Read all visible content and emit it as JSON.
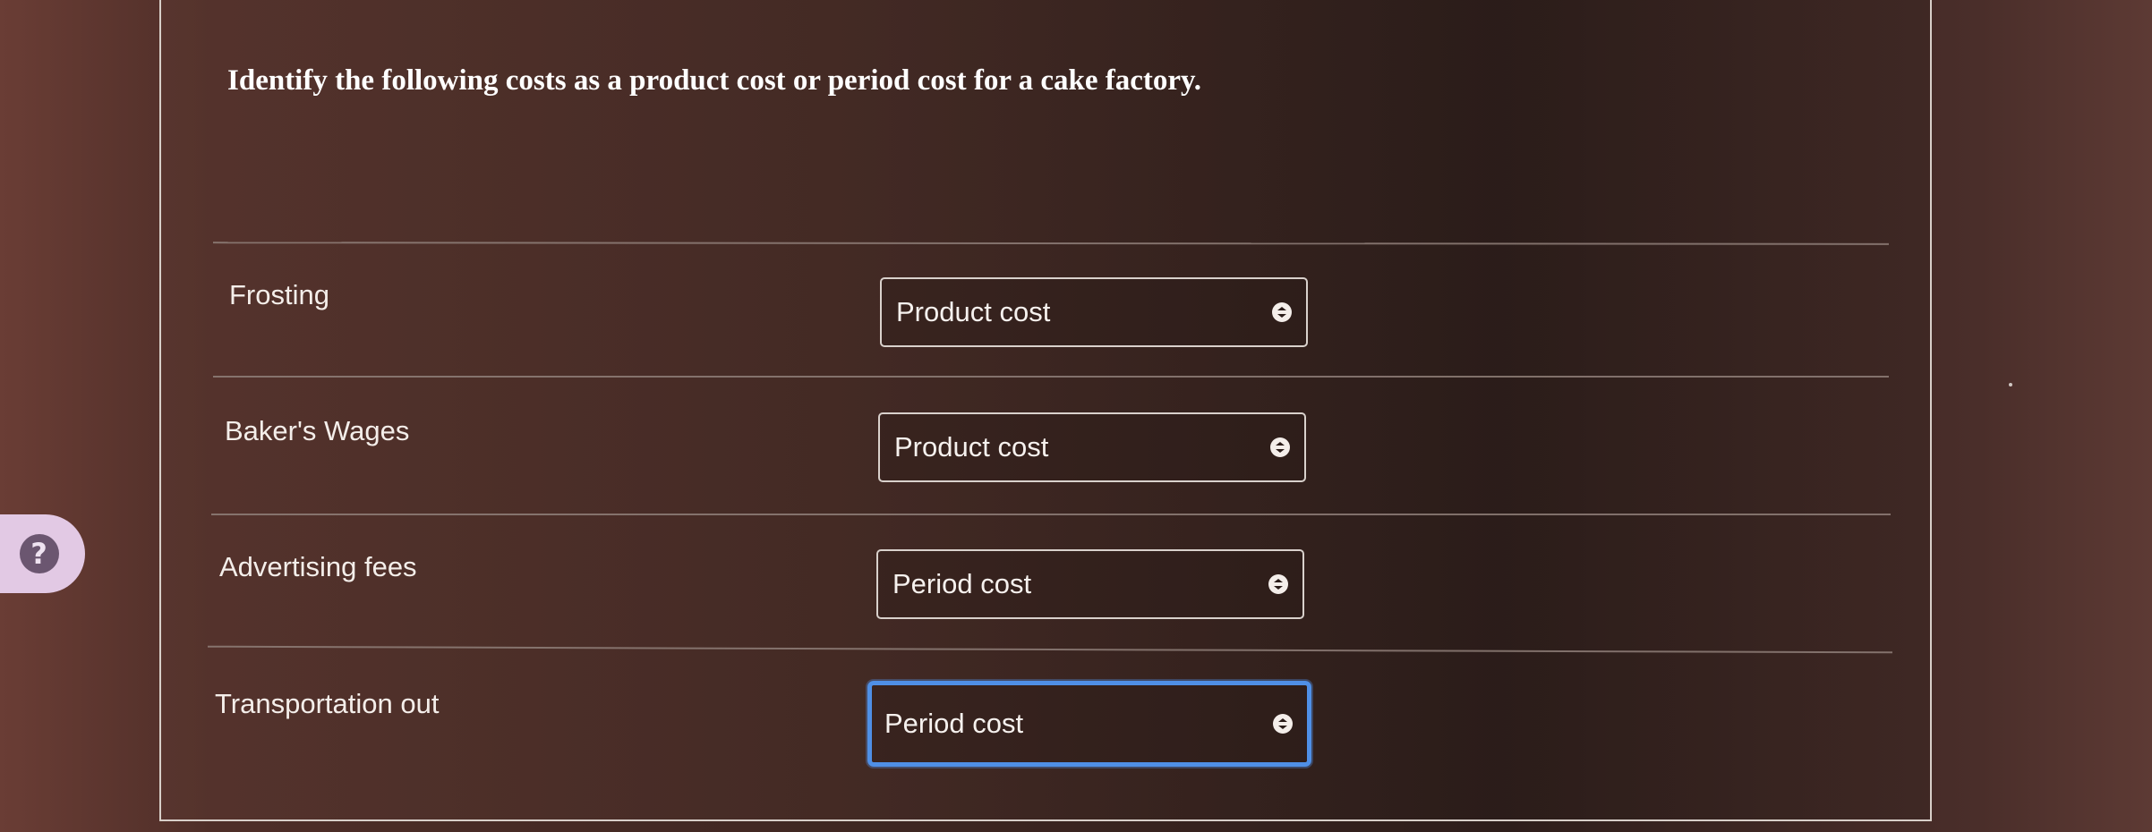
{
  "question": "Identify the following costs as a product cost or period cost for a cake factory.",
  "rows": [
    {
      "label": "Frosting",
      "selected": "Product cost"
    },
    {
      "label": "Baker's Wages",
      "selected": "Product cost"
    },
    {
      "label": "Advertising fees",
      "selected": "Period cost"
    },
    {
      "label": "Transportation out",
      "selected": "Period cost"
    }
  ],
  "help": {
    "icon": "question-mark-icon",
    "label": "?"
  },
  "colors": {
    "focus_border": "#4f8fe6",
    "help_bg": "#e2c9e4"
  }
}
